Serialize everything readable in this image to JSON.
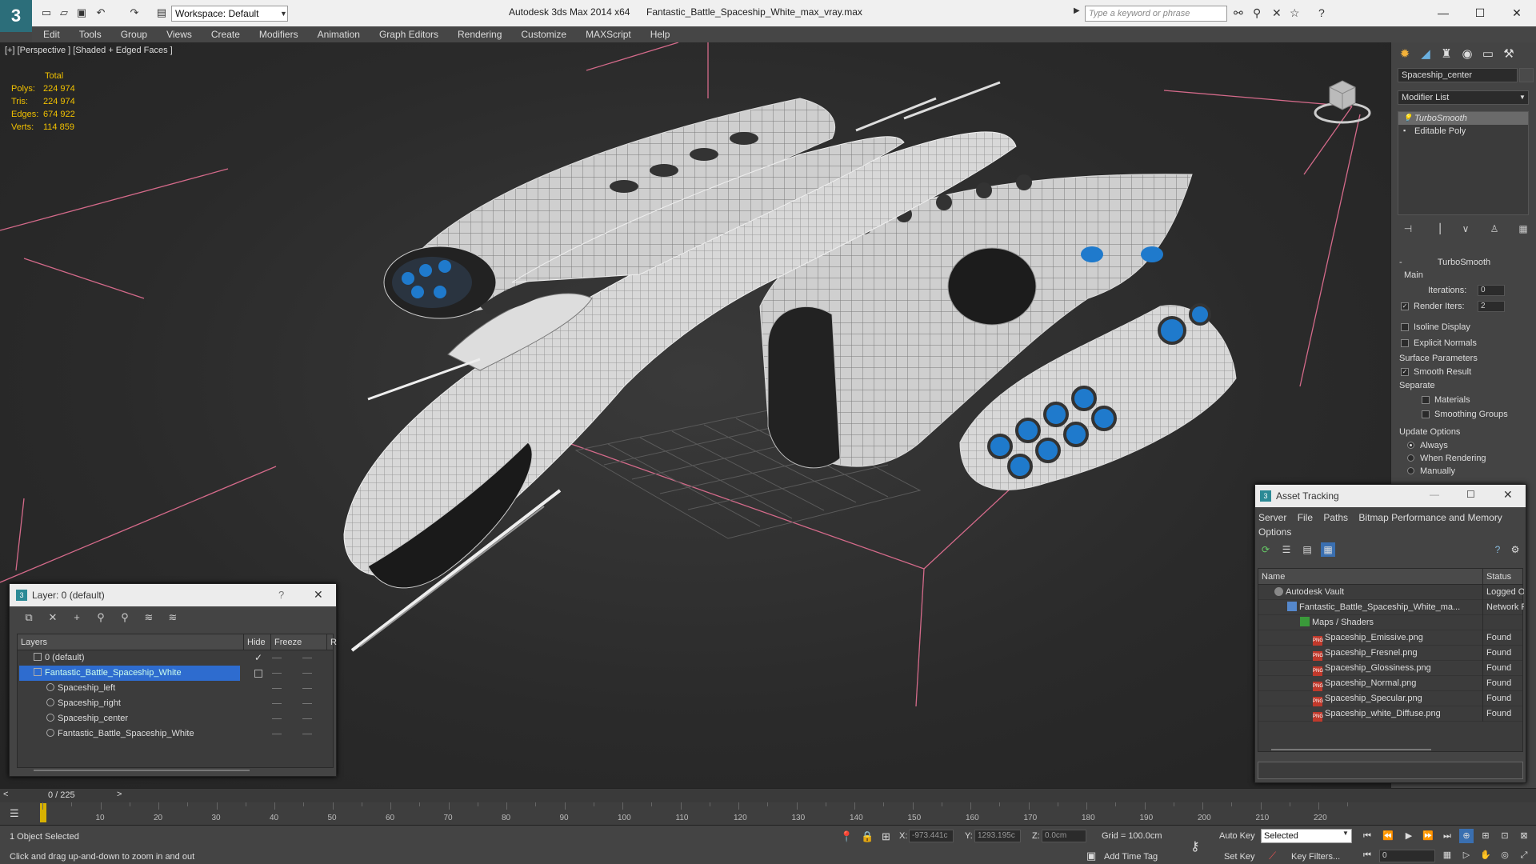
{
  "titlebar": {
    "workspace": "Workspace: Default",
    "app": "Autodesk 3ds Max  2014 x64",
    "file": "Fantastic_Battle_Spaceship_White_max_vray.max",
    "search_placeholder": "Type a keyword or phrase"
  },
  "menu": [
    "Edit",
    "Tools",
    "Group",
    "Views",
    "Create",
    "Modifiers",
    "Animation",
    "Graph Editors",
    "Rendering",
    "Customize",
    "MAXScript",
    "Help"
  ],
  "viewport": {
    "label": "[+] [Perspective ] [Shaded + Edged Faces ]",
    "stats": {
      "header": "Total",
      "rows": [
        {
          "k": "Polys:",
          "v": "224 974"
        },
        {
          "k": "Tris:",
          "v": "224 974"
        },
        {
          "k": "Edges:",
          "v": "674 922"
        },
        {
          "k": "Verts:",
          "v": "114 859"
        }
      ]
    }
  },
  "command_panel": {
    "object_name": "Spaceship_center",
    "modifier_list": "Modifier List",
    "stack": [
      "TurboSmooth",
      "Editable Poly"
    ],
    "rollout_title": "TurboSmooth",
    "main_group": "Main",
    "iterations_label": "Iterations:",
    "iterations": "0",
    "render_iters_label": "Render Iters:",
    "render_iters": "2",
    "isoline": "Isoline Display",
    "explicit": "Explicit Normals",
    "surface_group": "Surface Parameters",
    "smooth_result": "Smooth Result",
    "separate": "Separate",
    "materials": "Materials",
    "smoothing_groups": "Smoothing Groups",
    "update_group": "Update Options",
    "always": "Always",
    "when_rendering": "When Rendering",
    "manually": "Manually"
  },
  "asset_tracking": {
    "title": "Asset Tracking",
    "menu": [
      "Server",
      "File",
      "Paths",
      "Bitmap Performance and Memory",
      "Options"
    ],
    "col_name": "Name",
    "col_status": "Status",
    "rows": [
      {
        "name": "Autodesk Vault",
        "status": "Logged O"
      },
      {
        "name": "Fantastic_Battle_Spaceship_White_ma...",
        "status": "Network F"
      },
      {
        "name": "Maps / Shaders",
        "status": ""
      },
      {
        "name": "Spaceship_Emissive.png",
        "status": "Found"
      },
      {
        "name": "Spaceship_Fresnel.png",
        "status": "Found"
      },
      {
        "name": "Spaceship_Glossiness.png",
        "status": "Found"
      },
      {
        "name": "Spaceship_Normal.png",
        "status": "Found"
      },
      {
        "name": "Spaceship_Specular.png",
        "status": "Found"
      },
      {
        "name": "Spaceship_white_Diffuse.png",
        "status": "Found"
      }
    ]
  },
  "layer_dialog": {
    "title": "Layer: 0 (default)",
    "help": "?",
    "col_layers": "Layers",
    "col_hide": "Hide",
    "col_freeze": "Freeze",
    "col_r": "R",
    "rows": [
      {
        "name": "0 (default)"
      },
      {
        "name": "Fantastic_Battle_Spaceship_White"
      },
      {
        "name": "Spaceship_left"
      },
      {
        "name": "Spaceship_right"
      },
      {
        "name": "Spaceship_center"
      },
      {
        "name": "Fantastic_Battle_Spaceship_White"
      }
    ]
  },
  "timeline": {
    "frame": "0 / 225",
    "ticks": [
      "10",
      "20",
      "30",
      "40",
      "50",
      "60",
      "70",
      "80",
      "90",
      "100",
      "110",
      "120",
      "130",
      "140",
      "150",
      "160",
      "170",
      "180",
      "190",
      "200",
      "210",
      "220"
    ]
  },
  "status": {
    "selected": "1 Object Selected",
    "prompt": "Click and drag up-and-down to zoom in and out",
    "x_label": "X:",
    "x": "-973.441c",
    "y_label": "Y:",
    "y": "1293.195c",
    "z_label": "Z:",
    "z": "0.0cm",
    "grid": "Grid = 100.0cm",
    "add_time_tag": "Add Time Tag",
    "auto_key": "Auto Key",
    "set_key": "Set Key",
    "selected_mode": "Selected",
    "key_filters": "Key Filters...",
    "current_frame": "0"
  }
}
